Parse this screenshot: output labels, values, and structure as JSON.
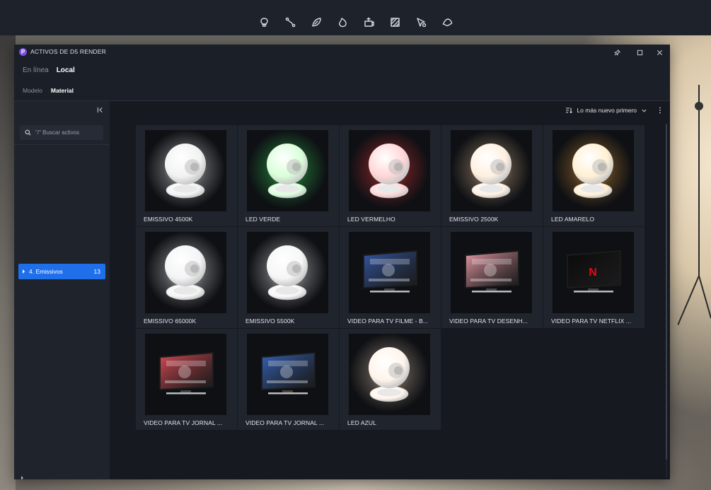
{
  "toolbar": {
    "icons": [
      "lightbulb-icon",
      "path-tool-icon",
      "leaf-icon",
      "fire-icon",
      "camera-rig-icon",
      "texture-icon",
      "cursor-pin-icon",
      "terrain-icon"
    ]
  },
  "window": {
    "logo_letter": "P",
    "title": "ACTIVOS DE D5 RENDER",
    "tabs": [
      {
        "label": "En línea",
        "active": false
      },
      {
        "label": "Local",
        "active": true
      }
    ],
    "subtabs": [
      {
        "label": "Modelo",
        "active": false
      },
      {
        "label": "Material",
        "active": true
      }
    ]
  },
  "sidebar": {
    "search_placeholder": "\"/\" Buscar activos",
    "selected_category": {
      "label": "4. Emissivos",
      "count": "13"
    },
    "cut_category": {
      "label": "…",
      "count": "…"
    }
  },
  "content": {
    "sort_label": "Lo más nuevo primero"
  },
  "assets": [
    {
      "label": "EMISSIVO 4500K",
      "kind": "sphere",
      "glow": "#ffffff",
      "tint": "#f2f2f2"
    },
    {
      "label": "LED VERDE",
      "kind": "sphere",
      "glow": "#39e05a",
      "tint": "#d8ffd8"
    },
    {
      "label": "LED VERMELHO",
      "kind": "sphere",
      "glow": "#ff3b3b",
      "tint": "#ffd6d6"
    },
    {
      "label": "EMISSIVO 2500K",
      "kind": "sphere",
      "glow": "#f1c89a",
      "tint": "#fff0e0"
    },
    {
      "label": "LED AMARELO",
      "kind": "sphere",
      "glow": "#f0a23a",
      "tint": "#fff0d4"
    },
    {
      "label": "EMISSIVO 65000K",
      "kind": "sphere",
      "glow": "#ffffff",
      "tint": "#f4f4f6"
    },
    {
      "label": "EMISSIVO 5500K",
      "kind": "sphere",
      "glow": "#ffffff",
      "tint": "#f6f6f6"
    },
    {
      "label": "VIDEO PARA TV FILME - B...",
      "kind": "tv",
      "screen": "#3457a6"
    },
    {
      "label": "VIDEO PARA TV DESENH...",
      "kind": "tv",
      "screen": "#e79aa6"
    },
    {
      "label": "VIDEO PARA TV NETFLIX ...",
      "kind": "tv-netflix",
      "screen": "#0a0a0a"
    },
    {
      "label": "VIDEO PARA TV JORNAL ...",
      "kind": "tv",
      "screen": "#d94a55"
    },
    {
      "label": "VIDEO PARA TV JORNAL ...",
      "kind": "tv",
      "screen": "#3563b8"
    },
    {
      "label": "LED AZUL",
      "kind": "sphere",
      "glow": "#e9cdb4",
      "tint": "#fff4ea"
    }
  ]
}
